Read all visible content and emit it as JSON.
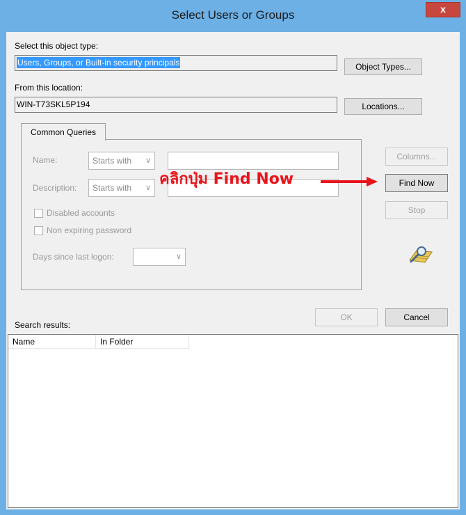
{
  "window": {
    "title": "Select Users or Groups",
    "close_label": "x"
  },
  "object_type": {
    "label": "Select this object type:",
    "value": "Users, Groups, or Built-in security principals",
    "button": "Object Types..."
  },
  "location": {
    "label": "From this location:",
    "value": "WIN-T73SKL5P194",
    "button": "Locations..."
  },
  "common_queries": {
    "tab_label": "Common Queries",
    "name_label": "Name:",
    "name_mode": "Starts with",
    "description_label": "Description:",
    "description_mode": "Starts with",
    "disabled_accounts": "Disabled accounts",
    "non_expiring_password": "Non expiring password",
    "days_label": "Days since last logon:"
  },
  "side_buttons": {
    "columns": "Columns...",
    "find_now": "Find Now",
    "stop": "Stop"
  },
  "annotation": {
    "text": "คลิกปุ่ม Find Now",
    "color": "#e8141b"
  },
  "dialog_buttons": {
    "ok": "OK",
    "cancel": "Cancel"
  },
  "results": {
    "label": "Search results:",
    "columns": [
      "Name",
      "In Folder"
    ]
  },
  "colors": {
    "title_bar": "#6cb0e6",
    "close_button": "#c7473e",
    "selection": "#3399ff"
  }
}
